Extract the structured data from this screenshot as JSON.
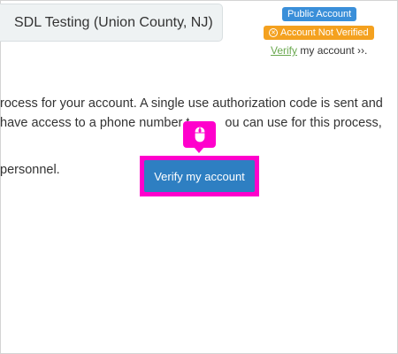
{
  "header": {
    "account_name": "SDL Testing (Union County, NJ)",
    "public_badge": "Public Account",
    "unverified_badge": "Account Not Verified",
    "verify_link": "Verify",
    "verify_rest": "my account ››."
  },
  "body": {
    "line1": "rocess for your account. A single use authorization code is sent and",
    "line2a": "have access to a phone number t",
    "line2b": "ou can use for this process,",
    "line3": "personnel."
  },
  "actions": {
    "verify_button": "Verify my account"
  },
  "icons": {
    "tooltip": "mouse-icon",
    "unverified": "x-circle-icon"
  },
  "colors": {
    "highlight": "#ff00cc",
    "button": "#2e7fc2",
    "public_badge": "#3a8fd9",
    "unverified_badge": "#f4a11f",
    "link": "#6aa84f"
  }
}
